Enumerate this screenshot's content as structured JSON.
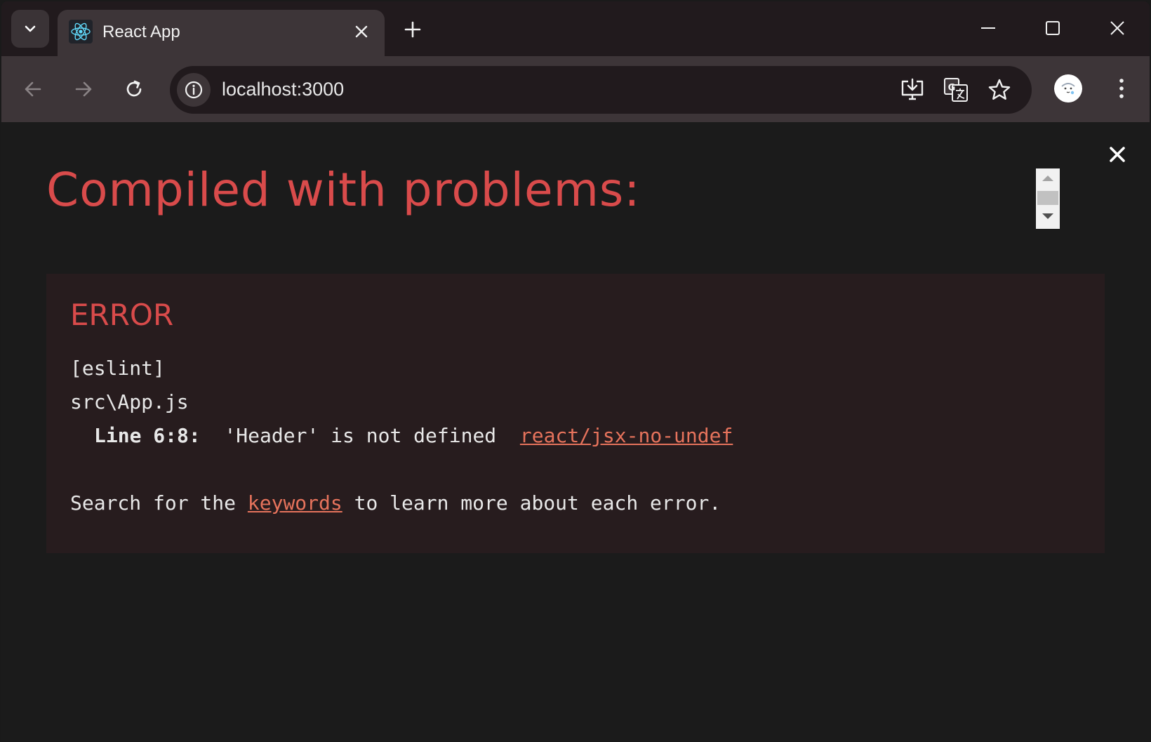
{
  "browser": {
    "tab": {
      "title": "React App",
      "favicon": "react-logo-icon"
    },
    "address_bar": {
      "url": "localhost:3000"
    },
    "icons": {
      "tab_search": "chevron-down-icon",
      "tab_close": "close-icon",
      "new_tab": "plus-icon",
      "minimize": "minimize-icon",
      "maximize": "maximize-icon",
      "window_close": "close-icon",
      "back": "back-arrow-icon",
      "forward": "forward-arrow-icon",
      "reload": "reload-icon",
      "site_info": "info-icon",
      "install_app": "install-app-icon",
      "translate": "translate-icon",
      "bookmark": "star-icon",
      "profile": "avatar",
      "menu": "kebab-menu-icon"
    }
  },
  "overlay": {
    "heading": "Compiled with problems:",
    "error": {
      "label": "ERROR",
      "source": "[eslint]",
      "file": "src\\App.js",
      "line_ref": "Line 6:8:",
      "message": "'Header' is not defined",
      "rule_link": "react/jsx-no-undef"
    },
    "hint": {
      "prefix": "Search for the ",
      "link": "keywords",
      "suffix": " to learn more about each error."
    }
  },
  "colors": {
    "error_red": "#d94b4b",
    "link": "#e6735c",
    "background": "#1b1b1b",
    "error_box": "#271c1e",
    "tab_strip": "#211a1d",
    "toolbar": "#3d3538"
  }
}
